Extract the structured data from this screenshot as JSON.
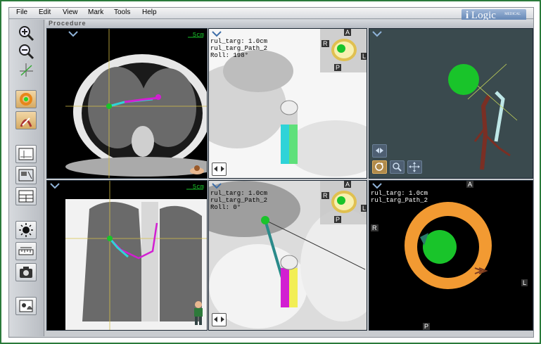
{
  "menu": {
    "items": [
      "File",
      "Edit",
      "View",
      "Mark",
      "Tools",
      "Help"
    ]
  },
  "logo": {
    "letter": "i",
    "name": "Logic",
    "tagline": "MEDICAL"
  },
  "panel_title": "Procedure",
  "views": {
    "axial_ct": {
      "scale_label": "5cm"
    },
    "coronal_ct": {
      "scale_label": "5cm"
    },
    "endo_top": {
      "line1": "rul_targ: 1.0cm",
      "line2": "rul_targ_Path_2",
      "line3": "Roll: 198°",
      "compass": {
        "top": "A",
        "left": "R",
        "right": "L",
        "bottom": "P"
      }
    },
    "endo_bottom": {
      "line1": "rul_targ: 1.0cm",
      "line2": "rul_targ_Path_2",
      "line3": "Roll: 0°",
      "compass": {
        "top": "A",
        "left": "R",
        "right": "L",
        "bottom": "P"
      }
    },
    "target_view": {
      "line1": "rul_targ: 1.0cm",
      "line2": "rul_targ_Path_2",
      "compass": {
        "top": "A",
        "left": "R",
        "right": "L",
        "bottom": "P"
      }
    }
  },
  "colors": {
    "target_green": "#19c42a",
    "path_magenta": "#d21fd2",
    "path_cyan": "#2fd3d8",
    "ring_orange": "#f29a32",
    "frame_green": "#2a7a3a"
  }
}
